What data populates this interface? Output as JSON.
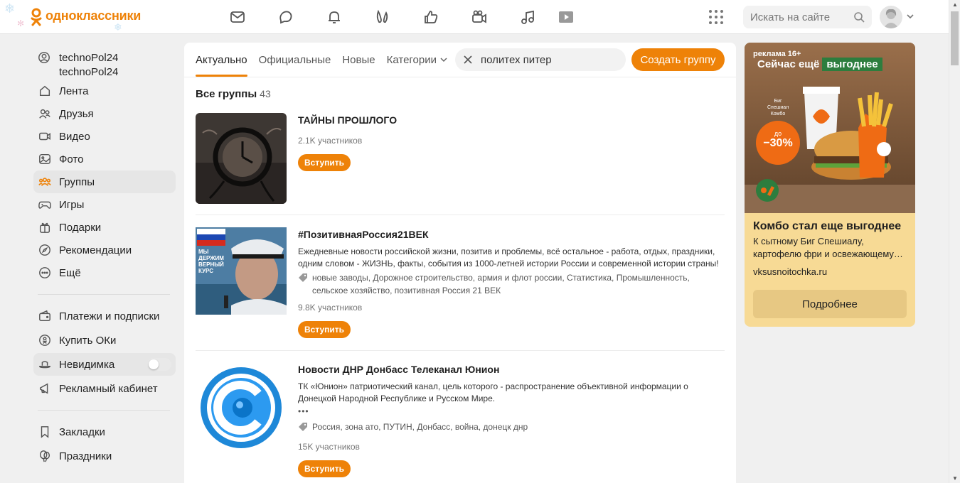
{
  "header": {
    "logo_text": "одноклассники",
    "search_placeholder": "Искать на сайте"
  },
  "sidebar": {
    "user": {
      "name": "technoPol24",
      "surname": "technoPol24"
    },
    "items": [
      {
        "label": "Лента"
      },
      {
        "label": "Друзья"
      },
      {
        "label": "Видео"
      },
      {
        "label": "Фото"
      },
      {
        "label": "Группы"
      },
      {
        "label": "Игры"
      },
      {
        "label": "Подарки"
      },
      {
        "label": "Рекомендации"
      },
      {
        "label": "Ещё"
      }
    ],
    "items2": [
      {
        "label": "Платежи и подписки"
      },
      {
        "label": "Купить ОКи"
      },
      {
        "label": "Невидимка"
      },
      {
        "label": "Рекламный кабинет"
      }
    ],
    "items3": [
      {
        "label": "Закладки"
      },
      {
        "label": "Праздники"
      }
    ]
  },
  "main": {
    "tabs": [
      {
        "label": "Актуально"
      },
      {
        "label": "Официальные"
      },
      {
        "label": "Новые"
      },
      {
        "label": "Категории"
      }
    ],
    "filter_value": "политех питер",
    "create_label": "Создать группу",
    "section_title": "Все группы",
    "section_count": "43",
    "join_label": "Вступить",
    "groups": [
      {
        "title": "ТАЙНЫ ПРОШЛОГО",
        "members": "2.1K участников"
      },
      {
        "title": "#ПозитивнаяРоссия21ВЕК",
        "desc": "Ежедневные новости российской жизни, позитив и проблемы, всё остальное - работа, отдых, праздники, одним словом - ЖИЗНЬ, факты, события из 1000-летней истории России и современной истории страны!",
        "tags": "новые заводы, Дорожное строительство, армия и флот россии, Статистика, Промышленность, сельское хозяйство, позитивная Россия 21 ВЕК",
        "members": "9.8K участников",
        "image_caption": "МЫ ДЕРЖИМ ВЕРНЫЙ КУРС"
      },
      {
        "title": "Новости ДНР Донбасс Телеканал Юнион",
        "desc": "ТК «Юнион» патриотический канал, цель которого - распространение объективной информации о Донецкой Народной Республике и Русском Мире.",
        "more": "•••",
        "tags": "Россия, зона ато, ПУТИН, Донбасс, война, донецк днр",
        "members": "15K участников"
      }
    ]
  },
  "ad": {
    "label": "реклама 16+",
    "headline_a": "Сейчас ещё",
    "headline_b": "выгоднее",
    "combo": "Биг Спешиал Комбо",
    "badge_small": "до",
    "badge_big": "−30%",
    "title": "Комбо стал еще выгоднее",
    "desc": "К сытному Биг Спешиалу, картофелю фри и освежающему…",
    "domain": "vksusnoitochka.ru",
    "button": "Подробнее"
  },
  "colors": {
    "accent": "#ee8208",
    "ad_bg": "#f7da95"
  }
}
